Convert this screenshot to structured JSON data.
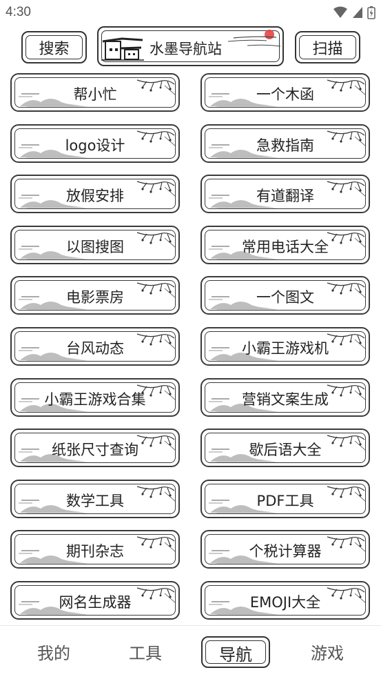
{
  "status_bar": {
    "time": "4:30"
  },
  "header": {
    "search_label": "搜索",
    "title": "水墨导航站",
    "scan_label": "扫描"
  },
  "tools": [
    {
      "label": "帮小忙"
    },
    {
      "label": "一个木函"
    },
    {
      "label": "logo设计"
    },
    {
      "label": "急救指南"
    },
    {
      "label": "放假安排"
    },
    {
      "label": "有道翻译"
    },
    {
      "label": "以图搜图"
    },
    {
      "label": "常用电话大全"
    },
    {
      "label": "电影票房"
    },
    {
      "label": "一个图文"
    },
    {
      "label": "台风动态"
    },
    {
      "label": "小霸王游戏机"
    },
    {
      "label": "小霸王游戏合集"
    },
    {
      "label": "营销文案生成"
    },
    {
      "label": "纸张尺寸查询"
    },
    {
      "label": "歇后语大全"
    },
    {
      "label": "数学工具"
    },
    {
      "label": "PDF工具"
    },
    {
      "label": "期刊杂志"
    },
    {
      "label": "个税计算器"
    },
    {
      "label": "网名生成器"
    },
    {
      "label": "EMOJI大全"
    }
  ],
  "bottom_nav": {
    "items": [
      {
        "label": "我的"
      },
      {
        "label": "工具"
      },
      {
        "label": "导航"
      },
      {
        "label": "游戏"
      }
    ],
    "active_index": 2
  },
  "colors": {
    "ink": "#333333",
    "seal_red": "#e23b3b",
    "background": "#ffffff"
  }
}
